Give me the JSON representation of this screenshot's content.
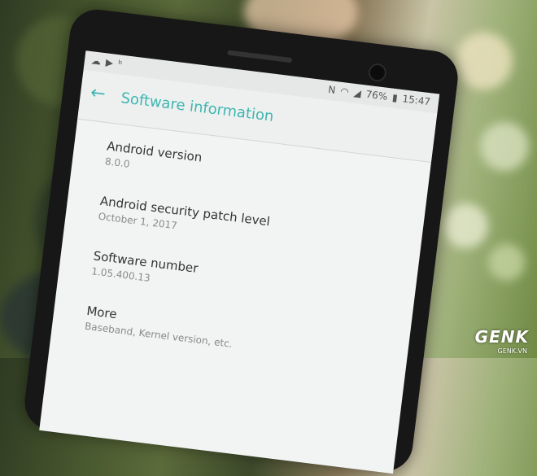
{
  "status": {
    "battery": "76%",
    "time": "15:47",
    "icons_left": [
      "cloud-upload-icon",
      "play-store-icon",
      "beats-icon"
    ],
    "icons_right": [
      "nfc-icon",
      "wifi-icon",
      "signal-icon",
      "battery-icon"
    ]
  },
  "header": {
    "back_icon": "←",
    "title": "Software information"
  },
  "items": [
    {
      "title": "Android version",
      "subtitle": "8.0.0"
    },
    {
      "title": "Android security patch level",
      "subtitle": "October 1, 2017"
    },
    {
      "title": "Software number",
      "subtitle": "1.05.400.13"
    },
    {
      "title": "More",
      "subtitle": "Baseband, Kernel version, etc."
    }
  ],
  "watermark": {
    "logo": "GENK",
    "sub": "GENK.VN"
  },
  "colors": {
    "accent": "#3fb6b0",
    "screen_bg": "#f2f3f3"
  }
}
